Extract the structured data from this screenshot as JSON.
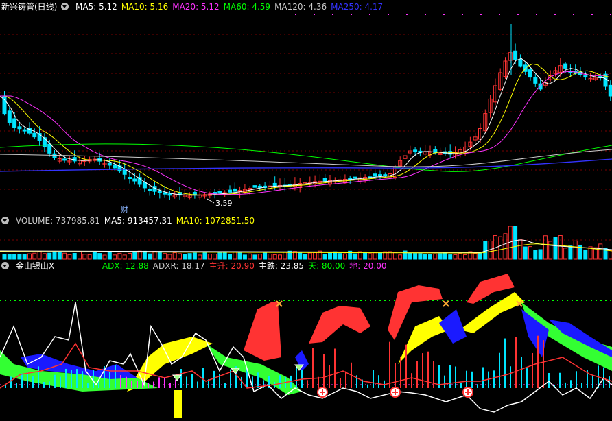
{
  "price_panel": {
    "title": "新兴铸管(日线)",
    "ma": [
      {
        "label": "MA5: 5.12",
        "color": "#ffffff"
      },
      {
        "label": "MA10: 5.16",
        "color": "#ffff00"
      },
      {
        "label": "MA20: 5.12",
        "color": "#ff33ff"
      },
      {
        "label": "MA60: 4.59",
        "color": "#00ff00"
      },
      {
        "label": "MA120: 4.36",
        "color": "#cccccc"
      },
      {
        "label": "MA250: 4.17",
        "color": "#3333ff"
      }
    ],
    "low_marker": "3.59",
    "event_marker": "财"
  },
  "volume_panel": {
    "items": [
      {
        "label": "VOLUME: 737985.81",
        "color": "#cccccc"
      },
      {
        "label": "MA5: 913457.31",
        "color": "#ffffff"
      },
      {
        "label": "MA10: 1072851.50",
        "color": "#ffff00"
      }
    ]
  },
  "indicator_panel": {
    "title": "金山银山X",
    "items": [
      {
        "label": "ADX: 12.88",
        "color": "#00ff00"
      },
      {
        "label": "ADXR: 18.17",
        "color": "#cccccc"
      },
      {
        "label": "主升: 20.90",
        "color": "#ff3333"
      },
      {
        "label": "主跌: 23.85",
        "color": "#ffffff"
      },
      {
        "label": "天: 80.00",
        "color": "#00ff00"
      },
      {
        "label": "地: 20.00",
        "color": "#ff33ff"
      }
    ]
  },
  "colors": {
    "up": "#ff3333",
    "down": "#00e5ff",
    "grid": "#8b0000",
    "separator": "#aa0000"
  }
}
